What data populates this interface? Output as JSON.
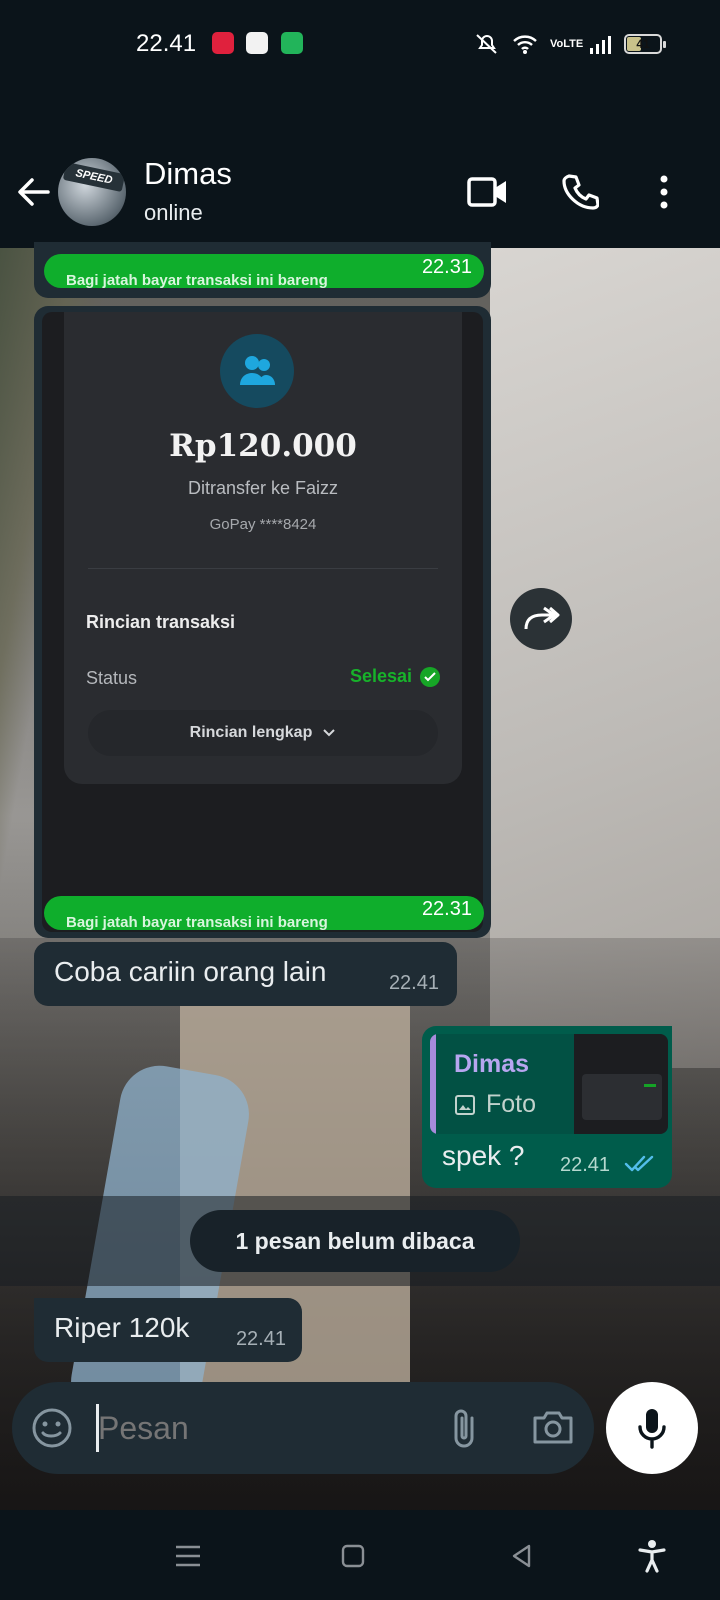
{
  "status_bar": {
    "time": "22.41",
    "battery": "41",
    "network": "VoLTE"
  },
  "header": {
    "contact_name": "Dimas",
    "contact_status": "online",
    "avatar_label": "SPEED",
    "icons": [
      "back-arrow-icon",
      "video-call-icon",
      "phone-icon",
      "more-vert-icon"
    ]
  },
  "messages": {
    "forwarded_image": {
      "amount": "Rp120.000",
      "transfer_to": "Ditransfer ke Faizz",
      "gopay_account": "GoPay ****8424",
      "rincian_title": "Rincian transaksi",
      "status_label": "Status",
      "status_value": "Selesai",
      "details_button": "Rincian lengkap",
      "caption_strip": "Bagi jatah bayar transaksi ini bareng",
      "caption_time": "22.31",
      "top_strip_time": "22.31"
    },
    "msg1": {
      "text": "Coba cariin orang lain",
      "time": "22.41"
    },
    "msg2": {
      "quote_name": "Dimas",
      "quote_type": "Foto",
      "text": "spek ?",
      "time": "22.41"
    },
    "unread_banner": "1 pesan belum dibaca",
    "msg3": {
      "text": "Riper 120k",
      "time": "22.41"
    }
  },
  "composer": {
    "placeholder": "Pesan"
  },
  "colors": {
    "incoming_bubble": "#1f2c34",
    "outgoing_bubble": "#005c4b",
    "accent_green": "#0fae2c",
    "read_ticks": "#53bdeb"
  }
}
